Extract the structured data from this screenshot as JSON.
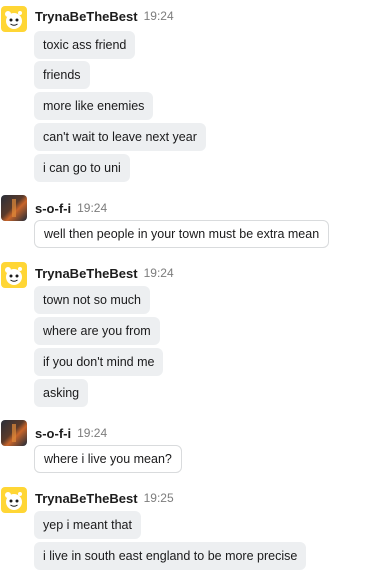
{
  "messages": [
    {
      "user": "TrynaBeTheBest",
      "time": "19:24",
      "avatar_icon": "snoo-avatar-icon",
      "lines": [
        "toxic ass friend",
        "friends",
        "more like enemies",
        "can't wait to leave next year",
        "i can go to uni"
      ]
    },
    {
      "user": "s-o-f-i",
      "time": "19:24",
      "avatar_icon": "photo-avatar-icon",
      "lines": [
        "well then people in your town must be extra mean"
      ]
    },
    {
      "user": "TrynaBeTheBest",
      "time": "19:24",
      "avatar_icon": "snoo-avatar-icon",
      "lines": [
        "town not so much",
        "where are you from",
        "if you don't mind me",
        "asking"
      ]
    },
    {
      "user": "s-o-f-i",
      "time": "19:24",
      "avatar_icon": "photo-avatar-icon",
      "lines": [
        "where i live you mean?"
      ]
    },
    {
      "user": "TrynaBeTheBest",
      "time": "19:25",
      "avatar_icon": "snoo-avatar-icon",
      "lines": [
        "yep i meant that",
        "i live in south east england to be more precise"
      ]
    }
  ],
  "colors": {
    "bubble_bg": "#edeff1",
    "snoo_bg": "#ffd635",
    "username": "#1c1c1c",
    "timestamp": "#7c7c7c"
  }
}
